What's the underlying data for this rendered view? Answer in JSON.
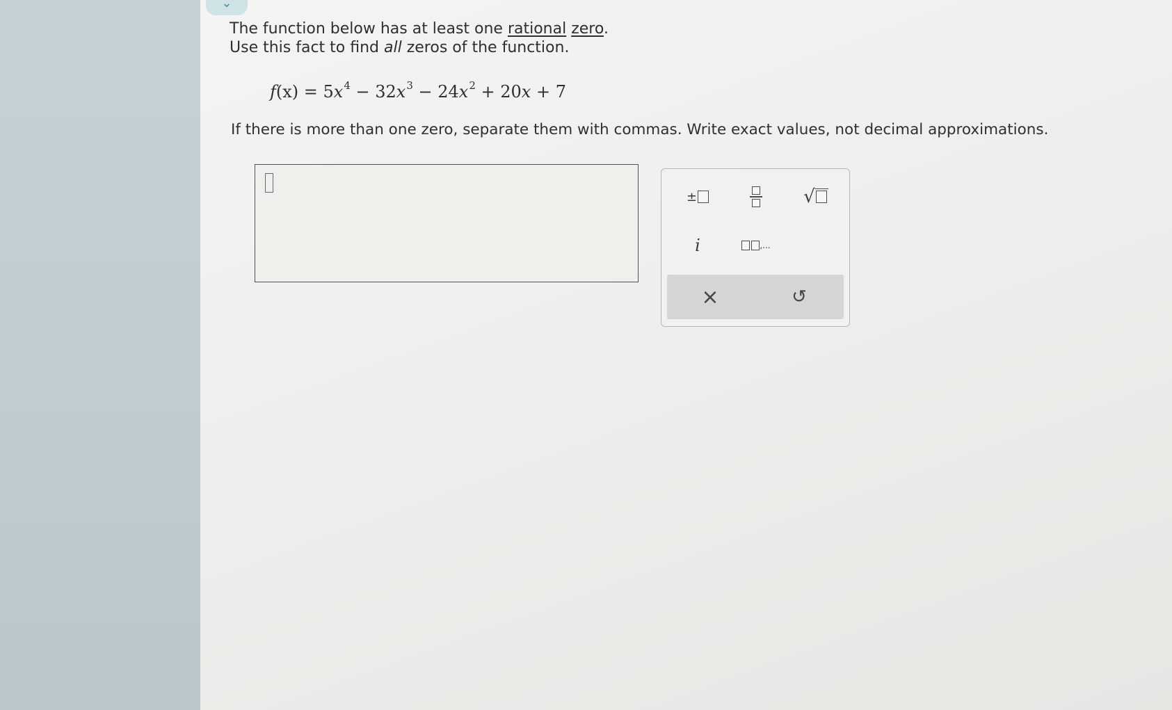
{
  "question": {
    "line1_prefix": "The function below has at least one ",
    "line1_link1": "rational",
    "line1_space": " ",
    "line1_link2": "zero",
    "line1_suffix": ".",
    "line2_prefix": "Use this fact to find ",
    "line2_em": "all",
    "line2_suffix": " zeros of the function."
  },
  "equation": {
    "f": "f",
    "lhs_arg": "(x)",
    "eq": " = 5",
    "x1": "x",
    "p4": "4",
    "t2": " − 32",
    "x2": "x",
    "p3": "3",
    "t3": " − 24",
    "x3": "x",
    "p2": "2",
    "t4": " + 20",
    "x4": "x",
    "t5": " + 7"
  },
  "note": "If there is more than one zero, separate them with commas. Write exact values, not decimal approximations.",
  "answer": {
    "value": ""
  },
  "palette": {
    "plus_minus": "±",
    "imaginary": "i",
    "list_suffix": ",...",
    "clear": "×",
    "undo": "↺"
  },
  "nav": {
    "chevron": "⌄"
  }
}
